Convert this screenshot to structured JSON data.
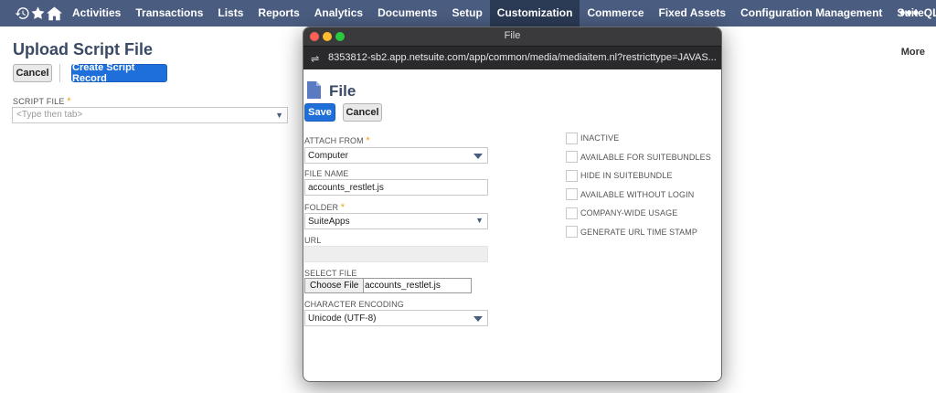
{
  "nav": {
    "items": [
      "Activities",
      "Transactions",
      "Lists",
      "Reports",
      "Analytics",
      "Documents",
      "Setup",
      "Customization",
      "Commerce",
      "Fixed Assets",
      "Configuration Management",
      "SuiteQL"
    ],
    "active": "Customization",
    "more": "•••"
  },
  "page": {
    "title": "Upload Script File",
    "cancel_label": "Cancel",
    "create_label": "Create Script Record",
    "script_file_label": "SCRIPT FILE",
    "script_file_placeholder": "<Type then tab>",
    "more_label": "More",
    "required_mark": "*"
  },
  "popup": {
    "window_title": "File",
    "url": "8353812-sb2.app.netsuite.com/app/common/media/mediaitem.nl?restricttype=JAVAS...",
    "title": "File",
    "save_label": "Save",
    "cancel_label": "Cancel",
    "attach_from_label": "ATTACH FROM",
    "attach_from_value": "Computer",
    "file_name_label": "FILE NAME",
    "file_name_value": "accounts_restlet.js",
    "folder_label": "FOLDER",
    "folder_value": "SuiteApps",
    "url_label": "URL",
    "url_value": "",
    "select_file_label": "SELECT FILE",
    "choose_file_label": "Choose File",
    "chosen_file": "accounts_restlet.js",
    "encoding_label": "CHARACTER ENCODING",
    "encoding_value": "Unicode (UTF-8)",
    "checkboxes": [
      {
        "label": "INACTIVE",
        "checked": false
      },
      {
        "label": "AVAILABLE FOR SUITEBUNDLES",
        "checked": false
      },
      {
        "label": "HIDE IN SUITEBUNDLE",
        "checked": false
      },
      {
        "label": "AVAILABLE WITHOUT LOGIN",
        "checked": false
      },
      {
        "label": "COMPANY-WIDE USAGE",
        "checked": false
      },
      {
        "label": "GENERATE URL TIME STAMP",
        "checked": false
      }
    ]
  },
  "colors": {
    "nav_bg": "#4a5d80",
    "nav_active": "#2b3a55",
    "primary_button": "#1e6fd9",
    "required": "#e8a317"
  }
}
